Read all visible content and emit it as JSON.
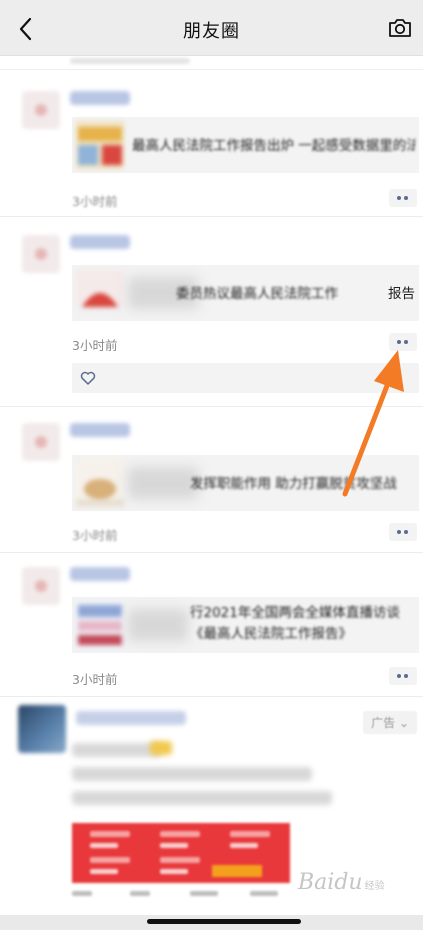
{
  "header": {
    "title": "朋友圈",
    "back_icon": "chevron-left-icon",
    "camera_icon": "camera-icon"
  },
  "posts": [
    {
      "card_text": "最高人民法院工作报告出炉 一起感受数据里的法治中国",
      "clear_tail": "",
      "time": "3小时前",
      "time_blurred": true,
      "thumb_colors": [
        "#e7b24a",
        "#8fb3d9",
        "#d9473f"
      ]
    },
    {
      "card_text": "委员热议最高人民法院工作",
      "clear_tail": "报告",
      "time": "3小时前",
      "time_blurred": false,
      "thumb_colors": [
        "#d9473f",
        "#f1f1f1",
        "#c83a32"
      ]
    },
    {
      "card_text": "发挥职能作用 助力打赢脱贫攻坚战",
      "clear_tail": "",
      "time": "3小时前",
      "time_blurred": false,
      "thumb_colors": [
        "#d8b07a",
        "#e8e0d2",
        "#b77e4a"
      ]
    },
    {
      "card_text": "行2021年全国两会全媒体直播访谈 《最高人民法院工作报告》",
      "clear_tail": "",
      "time": "3小时前",
      "time_blurred": false,
      "thumb_colors": [
        "#8fa7d6",
        "#e7b7c6",
        "#c34a58"
      ]
    }
  ],
  "post1": {
    "like_icon": "heart-outline-icon"
  },
  "more_icon": "more-dots-icon",
  "ad": {
    "badge": "广告"
  },
  "watermark": {
    "brand": "Baidu",
    "sub": "经验"
  },
  "annotation": {
    "arrow_color": "#f47b26",
    "target": "more-dots-icon"
  },
  "colors": {
    "header_bg": "#ededed",
    "link_blue": "#5b6a91",
    "time_gray": "#8a8a8a"
  }
}
